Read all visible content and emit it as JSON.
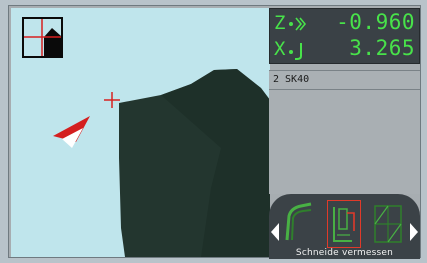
{
  "coordinates": {
    "z": {
      "axis": "Z",
      "icon": "z-axis-direction-icon",
      "value": "-0.960"
    },
    "x": {
      "axis": "X",
      "icon": "x-axis-direction-icon",
      "value": "3.265"
    }
  },
  "tool": {
    "line": "2  SK40"
  },
  "softkeys": {
    "label": "Schneide vermessen",
    "icons": [
      "tool-profile-icon",
      "caliper-measure-icon",
      "grid-view-icon"
    ],
    "selected_index": 1
  },
  "colors": {
    "display_green": "#48e24a",
    "sky": "#bfe5ec",
    "workpiece": "#23362f",
    "crosshair": "#d72020",
    "selection": "#e03a2a"
  }
}
